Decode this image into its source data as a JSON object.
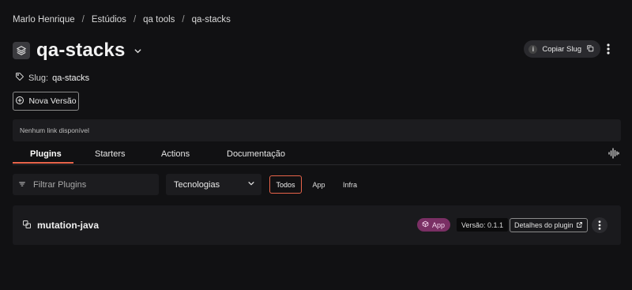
{
  "breadcrumb": [
    "Marlo Henrique",
    "Estúdios",
    "qa tools",
    "qa-stacks"
  ],
  "breadcrumb_separator": "/",
  "header": {
    "title": "qa-stacks",
    "copy_slug_label": "Copiar Slug"
  },
  "slug": {
    "label": "Slug:",
    "value": "qa-stacks"
  },
  "new_version_label": "Nova Versão",
  "links_banner_text": "Nenhum link disponível",
  "tabs": [
    {
      "label": "Plugins",
      "active": true
    },
    {
      "label": "Starters",
      "active": false
    },
    {
      "label": "Actions",
      "active": false
    },
    {
      "label": "Documentação",
      "active": false
    }
  ],
  "filters": {
    "search_placeholder": "Filtrar Plugins",
    "technologies_label": "Tecnologias",
    "chips": [
      {
        "label": "Todos",
        "active": true
      },
      {
        "label": "App",
        "active": false
      },
      {
        "label": "Infra",
        "active": false
      }
    ]
  },
  "plugins": [
    {
      "name": "mutation-java",
      "type_badge": "App",
      "version": "Versão: 0.1.1",
      "details_label": "Detalhes do plugin"
    }
  ],
  "colors": {
    "background": "#111113",
    "accent": "#e8644a",
    "badge_app": "#7a2f64"
  },
  "icons": {
    "stack": "layers-icon",
    "tag": "tag-icon",
    "plus": "plus-circle-icon",
    "filter": "filter-icon",
    "chevron": "chevron-down-icon",
    "copy": "copy-icon",
    "more": "more-vertical-icon",
    "plugin": "plugin-icon",
    "external": "external-link-icon",
    "audio": "waveform-icon"
  }
}
